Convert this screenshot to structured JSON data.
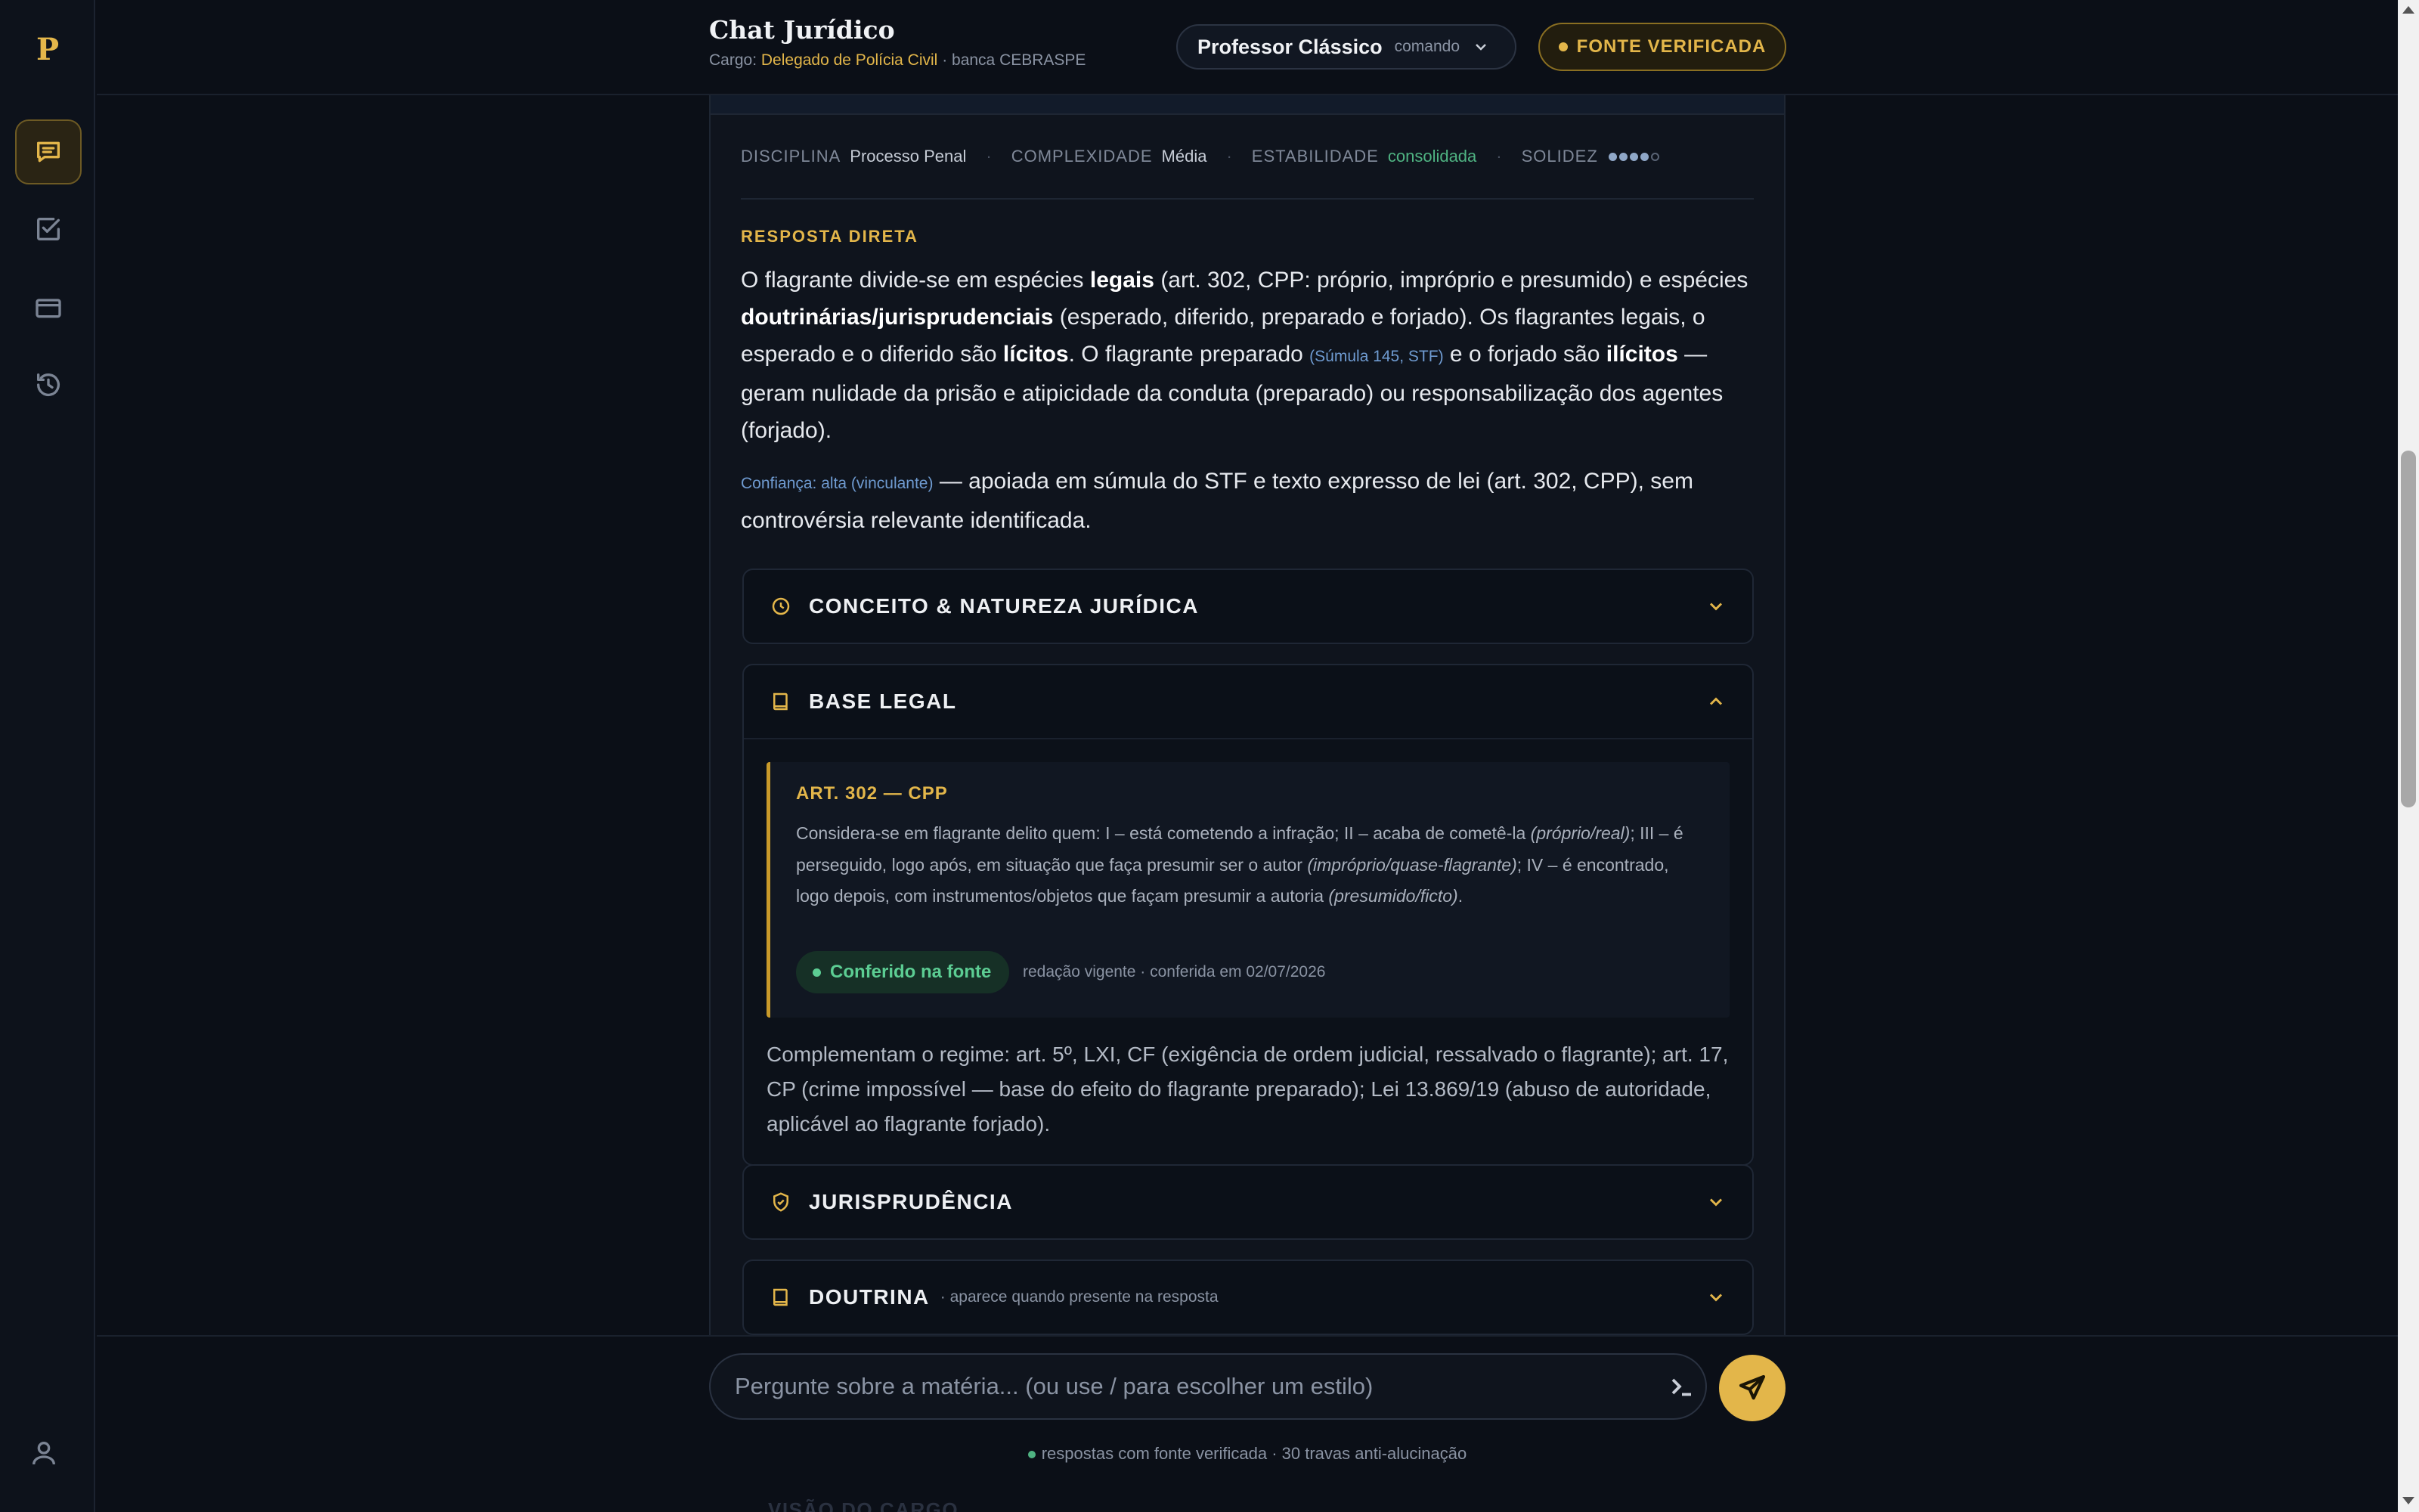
{
  "sidebar": {
    "logo": "P",
    "items": [
      {
        "name": "chat",
        "icon": "chat-bubble-icon",
        "active": true
      },
      {
        "name": "tasks",
        "icon": "checkbox-icon",
        "active": false
      },
      {
        "name": "cards",
        "icon": "card-icon",
        "active": false
      },
      {
        "name": "history",
        "icon": "history-icon",
        "active": false
      }
    ],
    "user_icon": "user-icon"
  },
  "header": {
    "title": "Chat Jurídico",
    "cargo_label": "Cargo:",
    "cargo_value": "Delegado de Polícia Civil",
    "banca": "· banca CEBRASPE",
    "mode_name": "Professor Clássico",
    "mode_hint": "comando",
    "fonte_button": "FONTE VERIFICADA"
  },
  "meta": {
    "disciplina_label": "DISCIPLINA",
    "disciplina_value": "Processo Penal",
    "complexidade_label": "COMPLEXIDADE",
    "complexidade_value": "Média",
    "estabilidade_label": "ESTABILIDADE",
    "estabilidade_value": "consolidada",
    "solidez_label": "SOLIDEZ",
    "solidez_level": 4,
    "solidez_max": 5,
    "separator": "·"
  },
  "answer": {
    "section_label": "RESPOSTA DIRETA",
    "p1": "O flagrante divide-se em espécies",
    "b1": "legais",
    "p2": "(art. 302, CPP: próprio, impróprio e presumido) e espécies",
    "b2": "doutrinárias/jurisprudenciais",
    "p3": "(esperado, diferido, preparado e forjado). Os flagrantes legais, o esperado e o diferido são",
    "b3": "lícitos",
    "p4": ". O flagrante preparado",
    "cite1": "(Súmula 145, STF)",
    "p5": "e o forjado são",
    "b4": "ilícitos",
    "p6": "— geram nulidade da prisão e atipicidade da conduta (preparado) ou responsabilização dos agentes (forjado).",
    "confidence_cite": "Confiança: alta (vinculante)",
    "confidence_text": "— apoiada em súmula do STF e texto expresso de lei (art. 302, CPP), sem controvérsia relevante identificada."
  },
  "accordions": [
    {
      "title": "CONCEITO & NATUREZA JURÍDICA",
      "icon": "clock-icon",
      "expanded": false
    },
    {
      "title": "BASE LEGAL",
      "icon": "book-icon",
      "expanded": true
    },
    {
      "title": "JURISPRUDÊNCIA",
      "icon": "shield-check-icon",
      "expanded": false
    },
    {
      "title": "DOUTRINA",
      "icon": "book-icon",
      "expanded": false,
      "note": "· aparece quando presente na resposta"
    }
  ],
  "base_legal": {
    "quote_title": "ART. 302 — CPP",
    "q1": "Considera-se em flagrante delito quem: I – está cometendo a infração; II – acaba de cometê-la",
    "q2": "(próprio/real)",
    "q3": "; III – é perseguido, logo após, em situação que faça presumir ser o autor",
    "q4": "(impróprio/quase-flagrante)",
    "q5": "; IV – é encontrado, logo depois, com instrumentos/objetos que façam presumir a autoria",
    "q6": "(presumido/ficto)",
    "q7": ".",
    "badge": "Conferido na fonte",
    "badge_note": "redação vigente · conferida em 02/07/2026",
    "complement": "Complementam o regime: art. 5º, LXI, CF (exigência de ordem judicial, ressalvado o flagrante); art. 17, CP (crime impossível — base do efeito do flagrante preparado); Lei 13.869/19 (abuso de autoridade, aplicável ao flagrante forjado)."
  },
  "ghost_next_section": "VISÃO DO CARGO",
  "composer": {
    "placeholder": "Pergunte sobre a matéria... (ou use / para escolher um estilo)",
    "footer": "respostas com fonte verificada · 30 travas anti-alucinação"
  },
  "colors": {
    "accent": "#e3b64a",
    "success": "#4fb382",
    "link": "#6f9bd1",
    "background": "#0b0f17"
  }
}
